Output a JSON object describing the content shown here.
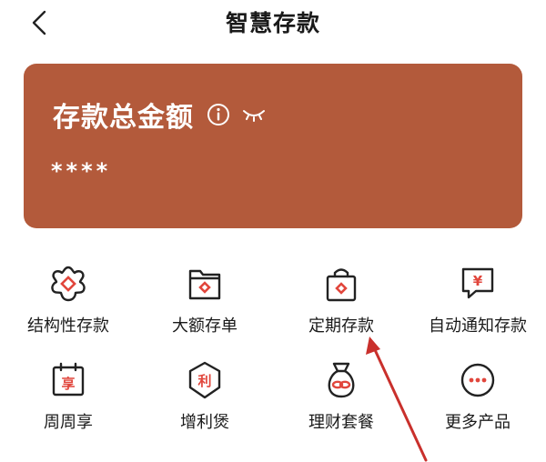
{
  "header": {
    "title": "智慧存款"
  },
  "card": {
    "title": "存款总金额",
    "masked_amount": "****",
    "bg_color": "#b35a3b"
  },
  "services": [
    {
      "label": "结构性存款",
      "icon": "gear-flower-icon"
    },
    {
      "label": "大额存单",
      "icon": "folder-icon"
    },
    {
      "label": "定期存款",
      "icon": "shopping-bag-icon"
    },
    {
      "label": "自动通知存款",
      "icon": "yen-message-icon"
    },
    {
      "label": "周周享",
      "icon": "calendar-icon",
      "glyph": "享"
    },
    {
      "label": "增利煲",
      "icon": "shield-icon",
      "glyph": "利"
    },
    {
      "label": "理财套餐",
      "icon": "money-bag-icon"
    },
    {
      "label": "更多产品",
      "icon": "more-icon"
    }
  ],
  "accent_red": "#e1463c"
}
